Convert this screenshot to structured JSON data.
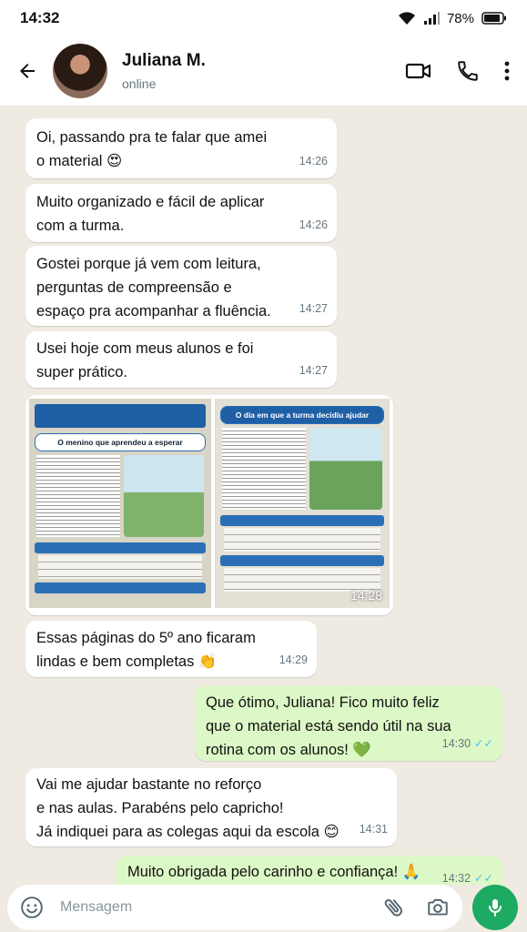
{
  "status_bar": {
    "time": "14:32",
    "battery": "78%"
  },
  "contact": {
    "name": "Juliana M.",
    "status": "online"
  },
  "messages": [
    {
      "text": "Oi, passando pra te falar que amei\no material 😍",
      "time": "14:26"
    },
    {
      "text": "Muito organizado e fácil de aplicar\ncom a turma.",
      "time": "14:26"
    },
    {
      "text": "Gostei porque já vem com leitura,\nperguntas de compreensão e\nespaço pra acompanhar a fluência.",
      "time": "14:27"
    },
    {
      "text": "Usei hoje com meus alunos e foi\nsuper prático.",
      "time": "14:27"
    },
    {
      "photo_time": "14:28",
      "photo1_title": "O menino que aprendeu a esperar",
      "photo2_title": "O dia em que a turma decidiu ajudar"
    },
    {
      "text": "Essas páginas do 5º ano ficaram\nlindas e bem completas 👏",
      "time": "14:29"
    },
    {
      "text": "Que ótimo,  Juliana! Fico muito feliz\nque o material está sendo útil na sua\nrotina com os alunos!  💚",
      "time": "14:30"
    },
    {
      "text": "Vai me ajudar bastante no reforço\ne nas aulas. Parabéns pelo capricho!\nJá indiquei para as colegas aqui da escola 😊",
      "time": "14:31"
    },
    {
      "text": "Muito obrigada pelo carinho e confiança! 🙏",
      "time": "14:32"
    }
  ],
  "input": {
    "placeholder": "Mensagem"
  },
  "colors": {
    "outgoing_bubble": "#dcf8c6",
    "incoming_bubble": "#ffffff",
    "read_ticks": "#53bdeb",
    "mic_button": "#1daa61",
    "chat_bg": "#efeae2"
  },
  "icons": [
    "back-arrow-icon",
    "video-call-icon",
    "phone-icon",
    "more-options-icon",
    "emoji-icon",
    "attach-icon",
    "camera-icon",
    "mic-icon",
    "wifi-icon",
    "signal-icon",
    "battery-icon"
  ]
}
